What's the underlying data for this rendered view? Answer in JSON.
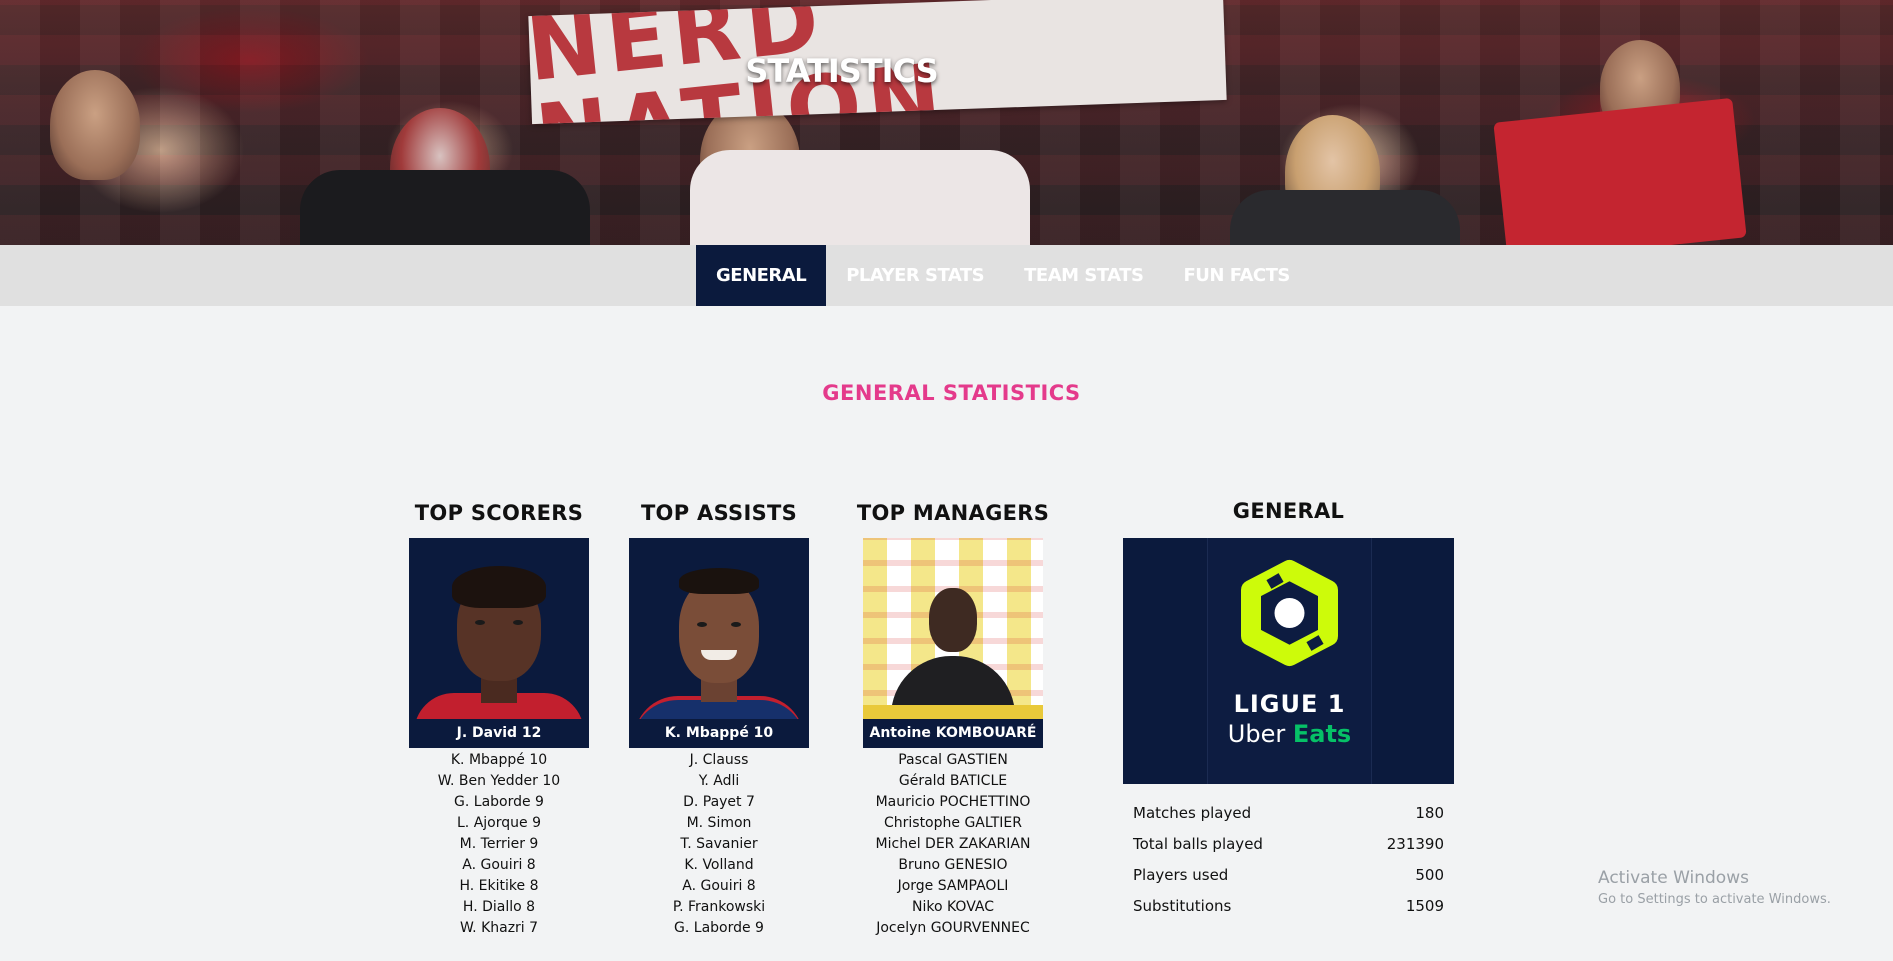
{
  "hero": {
    "title": "STATISTICS",
    "sign_text": "NERD NATION"
  },
  "nav": {
    "items": [
      {
        "label": "GENERAL",
        "active": true
      },
      {
        "label": "PLAYER STATS",
        "active": false
      },
      {
        "label": "TEAM STATS",
        "active": false
      },
      {
        "label": "FUN FACTS",
        "active": false
      }
    ]
  },
  "section": {
    "title": "GENERAL STATISTICS"
  },
  "top_scorers": {
    "heading": "TOP SCORERS",
    "featured": "J. David 12",
    "list": [
      "K. Mbappé 10",
      "W. Ben Yedder 10",
      "G. Laborde 9",
      "L. Ajorque 9",
      "M. Terrier 9",
      "A. Gouiri 8",
      "H. Ekitike 8",
      "H. Diallo 8",
      "W. Khazri 7"
    ]
  },
  "top_assists": {
    "heading": "TOP ASSISTS",
    "featured": "K. Mbappé 10",
    "list": [
      "J. Clauss",
      "Y. Adli",
      "D. Payet 7",
      "M. Simon",
      "T. Savanier",
      "K. Volland",
      "A. Gouiri 8",
      "P. Frankowski",
      "G. Laborde 9"
    ]
  },
  "top_managers": {
    "heading": "TOP MANAGERS",
    "featured": "Antoine KOMBOUARÉ",
    "list": [
      "Pascal GASTIEN",
      "Gérald BATICLE",
      "Mauricio POCHETTINO",
      "Christophe GALTIER",
      "Michel DER ZAKARIAN",
      "Bruno GENESIO",
      "Jorge SAMPAOLI",
      "Niko KOVAC",
      "Jocelyn GOURVENNEC"
    ]
  },
  "general": {
    "heading": "GENERAL",
    "logo_line1": "LIGUE 1",
    "logo_uber": "Uber",
    "logo_eats": "Eats",
    "stats": [
      {
        "label": "Matches played",
        "value": "180"
      },
      {
        "label": "Total balls played",
        "value": "231390"
      },
      {
        "label": "Players used",
        "value": "500"
      },
      {
        "label": "Substitutions",
        "value": "1509"
      }
    ]
  },
  "watermark": {
    "line1": "Activate Windows",
    "line2": "Go to Settings to activate Windows."
  },
  "colors": {
    "navy": "#0b1a3d",
    "accent_pink": "#e43a8b",
    "ligue_lime": "#cdfb0a",
    "eats_green": "#06c167"
  }
}
